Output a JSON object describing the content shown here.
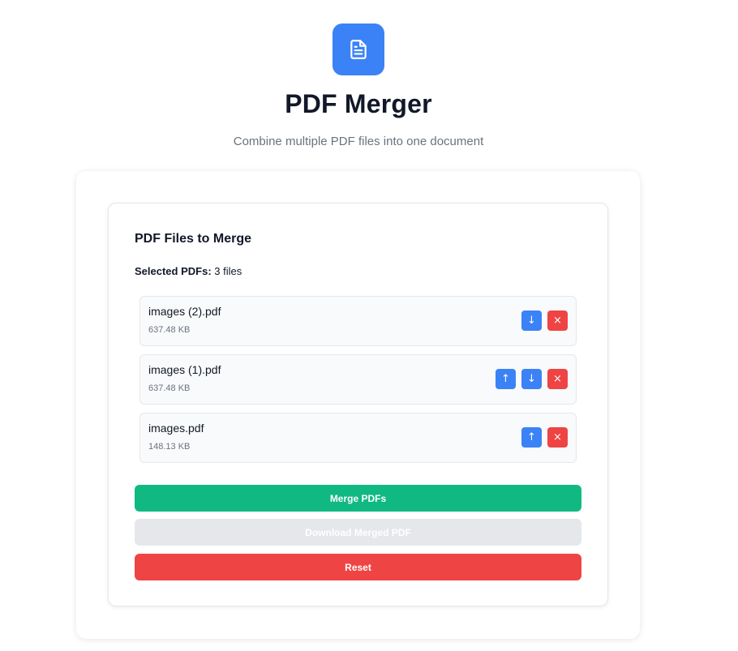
{
  "header": {
    "logo_icon": "document-icon",
    "title": "PDF Merger",
    "subtitle": "Combine multiple PDF files into one document"
  },
  "panel": {
    "section_title": "PDF Files to Merge",
    "selected_label": "Selected PDFs:",
    "selected_count": "3 files"
  },
  "files": [
    {
      "name": "images (2).pdf",
      "size": "637.48 KB",
      "up_label": "↑",
      "down_label": "↓",
      "remove_label": "×"
    },
    {
      "name": "images (1).pdf",
      "size": "637.48 KB",
      "up_label": "↑",
      "down_label": "↓",
      "remove_label": "×"
    },
    {
      "name": "images.pdf",
      "size": "148.13 KB",
      "up_label": "↑",
      "down_label": "↓",
      "remove_label": "×"
    }
  ],
  "actions": {
    "merge_label": "Merge PDFs",
    "download_label": "Download Merged PDF",
    "reset_label": "Reset"
  },
  "colors": {
    "accent": "#3b82f6",
    "success": "#10b981",
    "danger": "#ef4444",
    "disabled": "#e5e7eb"
  }
}
